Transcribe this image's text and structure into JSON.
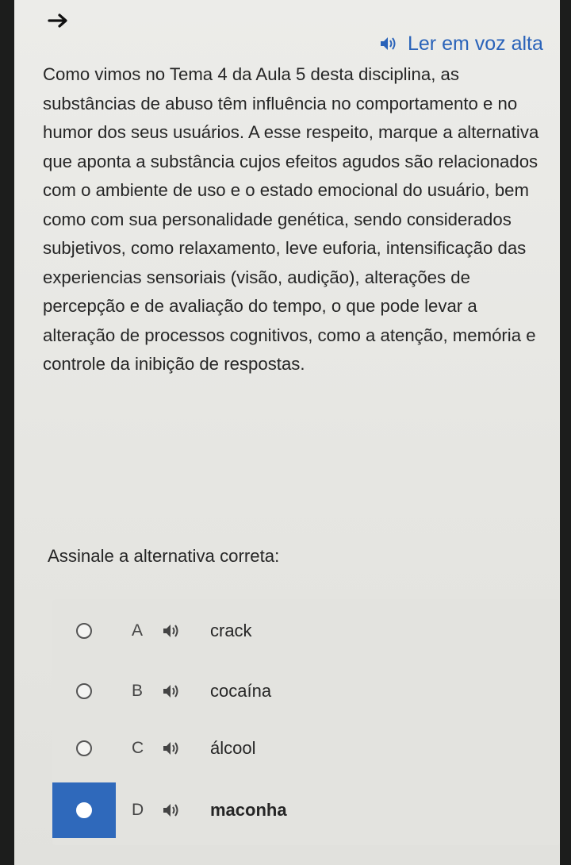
{
  "toolbar": {
    "read_aloud_label": "Ler em voz alta"
  },
  "question": {
    "text": "Como vimos no Tema 4 da Aula 5 desta disciplina, as substâncias de abuso têm influência no comportamento e no humor dos seus usuários. A esse respeito, marque a alternativa que aponta a substância cujos efeitos agudos são relacionados com o ambiente de uso e o estado emocional do usuário, bem como com sua personalidade genética, sendo considerados subjetivos, como relaxamento, leve euforia, intensificação das experiencias sensoriais (visão, audição), alterações de percepção e de avaliação do tempo, o que pode levar a alteração de processos cognitivos, como a atenção, memória e controle da inibição de respostas."
  },
  "prompt": "Assinale a alternativa correta:",
  "options": [
    {
      "letter": "A",
      "text": "crack",
      "selected": false
    },
    {
      "letter": "B",
      "text": "cocaína",
      "selected": false
    },
    {
      "letter": "C",
      "text": "álcool",
      "selected": false
    },
    {
      "letter": "D",
      "text": "maconha",
      "selected": true
    }
  ],
  "colors": {
    "accent": "#2f69bb",
    "text": "#262626",
    "link": "#2a63b9"
  },
  "icons": [
    "arrow-right-icon",
    "speaker-icon"
  ]
}
